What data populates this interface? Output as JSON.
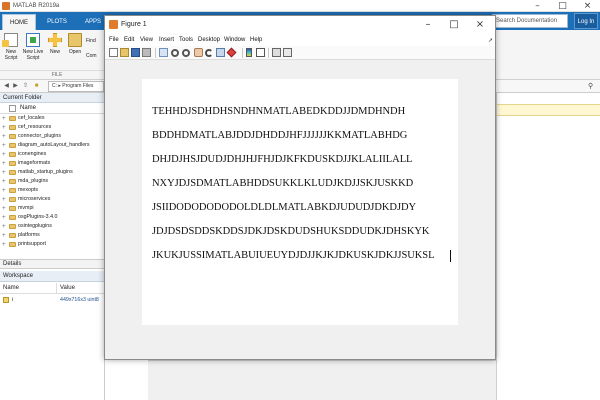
{
  "app": {
    "title": "MATLAB R2019a",
    "ribbon_tabs": [
      "HOME",
      "PLOTS",
      "APPS"
    ],
    "search_placeholder": "Search Documentation",
    "login_label": "Log In",
    "ribbon": {
      "new_script": "New Script",
      "new_live_script": "New Live Script",
      "new": "New",
      "open": "Open",
      "find_files": "Find",
      "compare": "Com",
      "section_label": "FILE"
    },
    "address_path": "C: ▸ Program Files"
  },
  "current_folder": {
    "header": "Current Folder",
    "column_name": "Name",
    "items": [
      "cef_locales",
      "cef_resources",
      "connector_plugins",
      "diagram_autoLayout_handlers",
      "iconengines",
      "imageformats",
      "matlab_startup_plugins",
      "mda_plugins",
      "mexopts",
      "microservices",
      "mvmpi",
      "osgPlugins-3.4.0",
      "osintegplugins",
      "platforms",
      "printsupport"
    ]
  },
  "details": {
    "label": "Details"
  },
  "workspace": {
    "header": "Workspace",
    "col_name": "Name",
    "col_value": "Value",
    "variables": [
      {
        "name": "i",
        "value": "449x716x3 uint8"
      }
    ]
  },
  "figure": {
    "title": "Figure 1",
    "menus": [
      "File",
      "Edit",
      "View",
      "Insert",
      "Tools",
      "Desktop",
      "Window",
      "Help"
    ],
    "text_lines": [
      "TEHHDJSDHDHSNDHNMATLABEDKDDJJDMDHNDH",
      "BDDHDMATLABJDDJDHDDJHFJJJJJJKKMATLABHDG",
      "DHJDJHSJDUDJDHJHJFHJDJKFKDUSKDJJKLALIILALL",
      "NXYJDJSDMATLABHDDSUKKLKLUDJKDJJSKJUSKKD",
      "JSIIDODODODODOLDLDLMATLABKDJUDUDJDKDJDY",
      "JDJDSDSDDSKDDSJDKJDSKDUDSHUKSDDUDKJDHSKYK",
      "JKUKJUSSIMATLABUIUEUYDJDJJKJKJDKUSKJDKJJSUKSL"
    ],
    "colors": {
      "ribbon_blue": "#1d6fb8",
      "icon_orange": "#e07b2c"
    }
  }
}
